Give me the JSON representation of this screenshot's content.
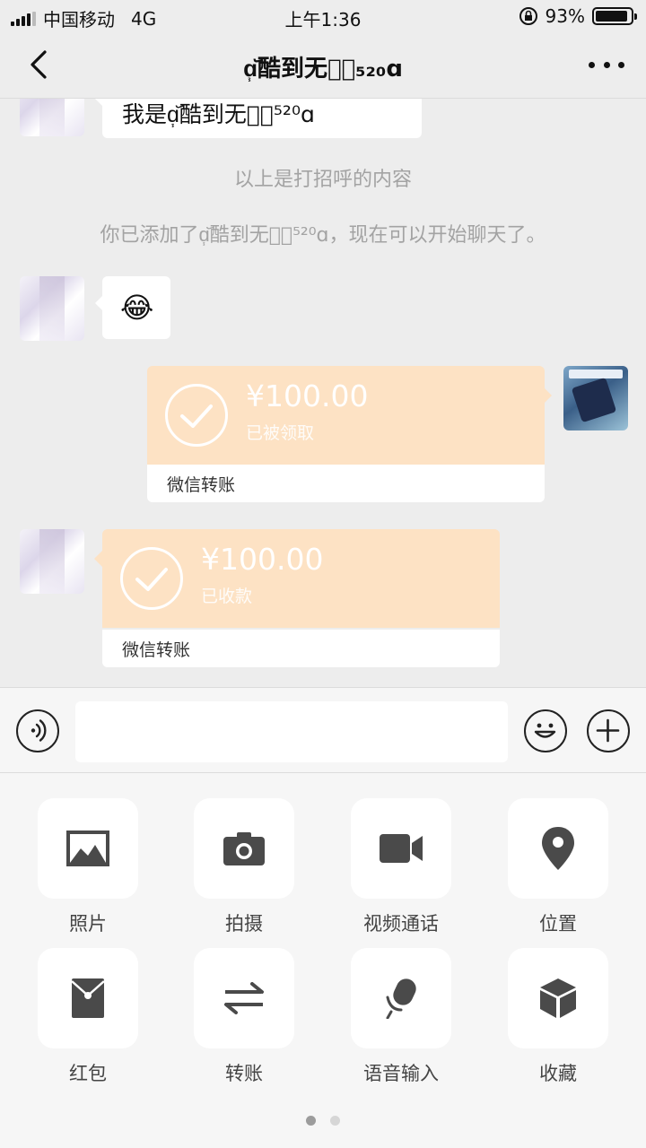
{
  "status_bar": {
    "carrier": "中国移动",
    "network": "4G",
    "time": "上午1:36",
    "battery_percent": "93%",
    "battery_level": 0.93
  },
  "nav": {
    "title": "ɑ᷂᷃酷到无边᷂₅₂₀ɑ"
  },
  "chat": {
    "first_message_partial": "我是ɑ᷂᷃酷到无边᷂⁵²⁰ɑ",
    "system_greeting": "以上是打招呼的内容",
    "system_added": "你已添加了ɑ᷂᷃酷到无边᷂⁵²⁰ɑ，现在可以开始聊天了。",
    "emoji_message": "😂",
    "transfer_sent": {
      "amount": "¥100.00",
      "status": "已被领取",
      "footer": "微信转账"
    },
    "transfer_received": {
      "amount": "¥100.00",
      "status": "已收款",
      "footer": "微信转账"
    }
  },
  "input": {
    "value": "",
    "placeholder": ""
  },
  "panel": {
    "items": [
      {
        "label": "照片",
        "icon": "photo-icon"
      },
      {
        "label": "拍摄",
        "icon": "camera-icon"
      },
      {
        "label": "视频通话",
        "icon": "video-call-icon"
      },
      {
        "label": "位置",
        "icon": "location-icon"
      },
      {
        "label": "红包",
        "icon": "red-packet-icon"
      },
      {
        "label": "转账",
        "icon": "transfer-icon"
      },
      {
        "label": "语音输入",
        "icon": "microphone-icon"
      },
      {
        "label": "收藏",
        "icon": "favorites-box-icon"
      }
    ],
    "page_index": 1,
    "page_count": 2
  },
  "colors": {
    "transfer_orange": "#fde2c4",
    "background": "#ededed",
    "icon_dark": "#4a4a4a"
  }
}
